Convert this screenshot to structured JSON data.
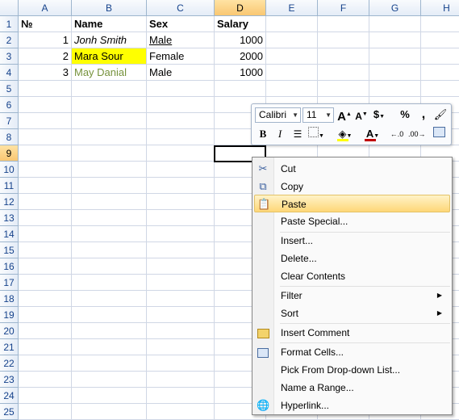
{
  "columns": [
    "A",
    "B",
    "C",
    "D",
    "E",
    "F",
    "G",
    "H"
  ],
  "active_column": "D",
  "active_row": 9,
  "rows": [
    "1",
    "2",
    "3",
    "4",
    "5",
    "6",
    "7",
    "8",
    "9",
    "10",
    "11",
    "12",
    "13",
    "14",
    "15",
    "16",
    "17",
    "18",
    "19",
    "20",
    "21",
    "22",
    "23",
    "24",
    "25"
  ],
  "sheet": {
    "header": {
      "no": "№",
      "name": "Name",
      "sex": "Sex",
      "salary": "Salary"
    },
    "records": [
      {
        "no": "1",
        "name": "Jonh Smith",
        "sex": "Male",
        "salary": "1000"
      },
      {
        "no": "2",
        "name": "Mara Sour",
        "sex": "Female",
        "salary": "2000"
      },
      {
        "no": "3",
        "name": "May Danial",
        "sex": "Male",
        "salary": "1000"
      }
    ]
  },
  "mini_toolbar": {
    "font_name": "Calibri",
    "font_size": "11",
    "grow_icon": "A",
    "shrink_icon": "A",
    "currency": "$",
    "percent": "%",
    "comma": ",",
    "bold": "B",
    "italic": "I",
    "font_color_letter": "A",
    "highlight_color": "#ffff00",
    "font_color": "#c00000"
  },
  "context_menu": {
    "items": [
      {
        "label": "Cut",
        "icon": "scissors-icon"
      },
      {
        "label": "Copy",
        "icon": "copy-icon"
      },
      {
        "label": "Paste",
        "icon": "paste-icon"
      },
      {
        "label": "Paste Special..."
      },
      {
        "label": "Insert..."
      },
      {
        "label": "Delete..."
      },
      {
        "label": "Clear Contents"
      },
      {
        "label": "Filter"
      },
      {
        "label": "Sort"
      },
      {
        "label": "Insert Comment",
        "icon": "comment-icon"
      },
      {
        "label": "Format Cells...",
        "icon": "format-cells-icon"
      },
      {
        "label": "Pick From Drop-down List..."
      },
      {
        "label": "Name a Range..."
      },
      {
        "label": "Hyperlink...",
        "icon": "hyperlink-icon"
      }
    ]
  }
}
